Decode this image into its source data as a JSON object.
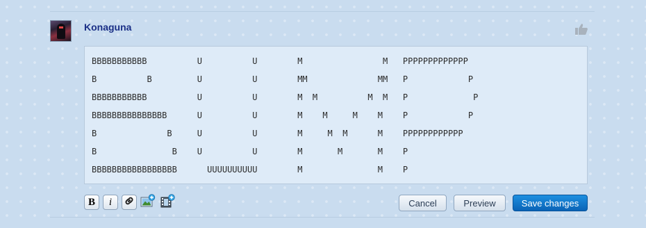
{
  "post": {
    "username": "Konaguna",
    "body": "BBBBBBBBBBB          U          U        M                M   PPPPPPPPPPPPP\nB          B         U          U        MM              MM   P            P\nBBBBBBBBBBB          U          U        M  M          M  M   P             P\nBBBBBBBBBBBBBBB      U          U        M    M     M    M    P            P\nB              B     U          U        M     M  M      M    PPPPPPPPPPPP\nB               B    U          U        M       M       M    P\nBBBBBBBBBBBBBBBBB      UUUUUUUUUU        M               M    P"
  },
  "icons": {
    "avatar": "avatar-image",
    "like": "thumbs-up-icon",
    "link": "link-icon",
    "image": "insert-image-icon",
    "media": "insert-media-icon"
  },
  "toolbar": {
    "bold_label": "B",
    "italic_label": "i"
  },
  "buttons": {
    "cancel": "Cancel",
    "preview": "Preview",
    "save": "Save changes"
  },
  "colors": {
    "username": "#1a2f86",
    "primary_button": "#0a63b6",
    "background": "#c9dcef",
    "editor_background": "#deebf8"
  }
}
